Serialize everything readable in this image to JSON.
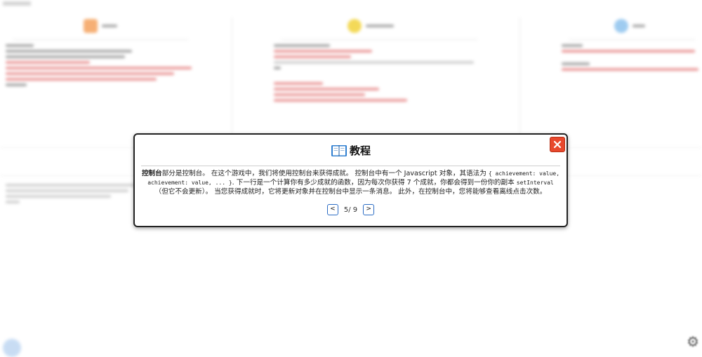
{
  "modal": {
    "title": "教程",
    "body_strong": "控制台",
    "body_1": "部分是控制台。 在这个游戏中，我们将使用控制台来获得成就。 控制台中有一个 Javascript 对象，其语法为 ",
    "body_code_1": "{ achievement: value, achievement: value, ... }",
    "body_2": ". 下一行是一个计算你有多少成就的函数，因为每次你获得 7 个成就，你都会得到一份你的副本 ",
    "body_code_2": "setInterval",
    "body_3": "（但它不会更新）。 当您获得成就时，它将更新对象并在控制台中显示一条消息。 此外，在控制台中，您将能够查看离线点击次数。",
    "pager": {
      "prev": "<",
      "text": "5/ 9",
      "next": ">"
    }
  },
  "colors": {
    "close_button": "#e8482d",
    "pager_border": "#2b6cc4",
    "background_red_text": "#e88a8a",
    "panel_icon_orange": "#f5a25d",
    "panel_icon_yellow": "#f2d33b",
    "panel_icon_blue": "#8ec3ee"
  },
  "icons": {
    "title": "book-icon",
    "close": "close-icon",
    "settings": "gear-icon"
  }
}
